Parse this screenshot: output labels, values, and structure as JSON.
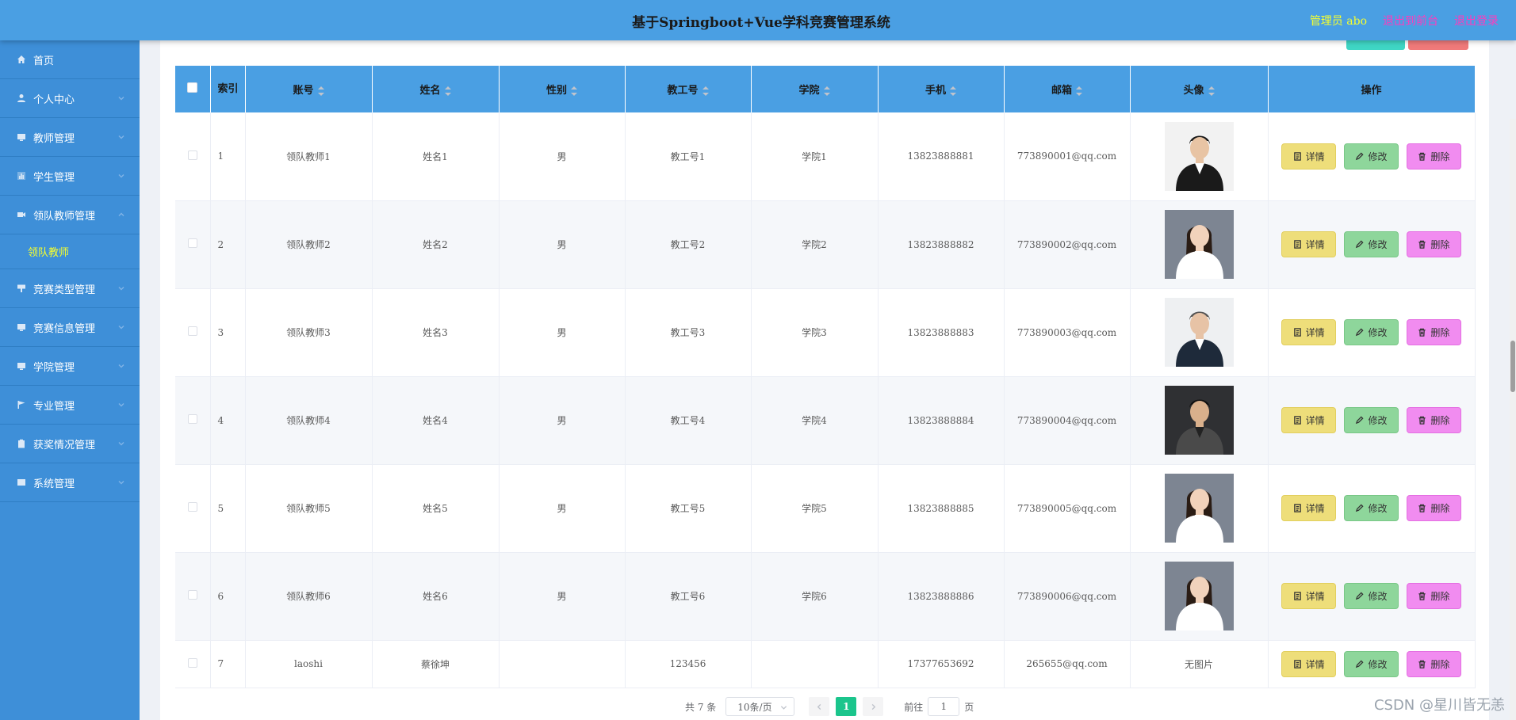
{
  "header": {
    "title": "基于Springboot+Vue学科竞赛管理系统",
    "admin_label": "管理员 abo",
    "to_front": "退出到前台",
    "logout": "退出登录"
  },
  "sidebar": {
    "items": [
      {
        "label": "首页",
        "icon": "home-icon"
      },
      {
        "label": "个人中心",
        "icon": "user-icon"
      },
      {
        "label": "教师管理",
        "icon": "monitor-icon"
      },
      {
        "label": "学生管理",
        "icon": "chart-icon"
      },
      {
        "label": "领队教师管理",
        "icon": "video-icon"
      },
      {
        "label": "竞赛类型管理",
        "icon": "flag-icon"
      },
      {
        "label": "竞赛信息管理",
        "icon": "monitor-icon"
      },
      {
        "label": "学院管理",
        "icon": "monitor-icon"
      },
      {
        "label": "专业管理",
        "icon": "flag-icon"
      },
      {
        "label": "获奖情况管理",
        "icon": "clipboard-icon"
      },
      {
        "label": "系统管理",
        "icon": "monitor-icon"
      }
    ],
    "active_sub": "领队教师"
  },
  "table": {
    "columns": {
      "index": "索引",
      "account": "账号",
      "name": "姓名",
      "gender": "性别",
      "staff_no": "教工号",
      "college": "学院",
      "phone": "手机",
      "email": "邮箱",
      "avatar": "头像",
      "ops": "操作"
    },
    "rows": [
      {
        "index": "1",
        "account": "领队教师1",
        "name": "姓名1",
        "gender": "男",
        "staff_no": "教工号1",
        "college": "学院1",
        "phone": "13823888881",
        "email": "773890001@qq.com"
      },
      {
        "index": "2",
        "account": "领队教师2",
        "name": "姓名2",
        "gender": "男",
        "staff_no": "教工号2",
        "college": "学院2",
        "phone": "13823888882",
        "email": "773890002@qq.com"
      },
      {
        "index": "3",
        "account": "领队教师3",
        "name": "姓名3",
        "gender": "男",
        "staff_no": "教工号3",
        "college": "学院3",
        "phone": "13823888883",
        "email": "773890003@qq.com"
      },
      {
        "index": "4",
        "account": "领队教师4",
        "name": "姓名4",
        "gender": "男",
        "staff_no": "教工号4",
        "college": "学院4",
        "phone": "13823888884",
        "email": "773890004@qq.com"
      },
      {
        "index": "5",
        "account": "领队教师5",
        "name": "姓名5",
        "gender": "男",
        "staff_no": "教工号5",
        "college": "学院5",
        "phone": "13823888885",
        "email": "773890005@qq.com"
      },
      {
        "index": "6",
        "account": "领队教师6",
        "name": "姓名6",
        "gender": "男",
        "staff_no": "教工号6",
        "college": "学院6",
        "phone": "13823888886",
        "email": "773890006@qq.com"
      },
      {
        "index": "7",
        "account": "laoshi",
        "name": "蔡徐坤",
        "gender": "",
        "staff_no": "123456",
        "college": "",
        "phone": "17377653692",
        "email": "265655@qq.com",
        "avatar_text": "无图片"
      }
    ],
    "actions": {
      "detail": "详情",
      "edit": "修改",
      "delete": "删除"
    }
  },
  "pagination": {
    "total": "共 7 条",
    "page_size": "10条/页",
    "current_page": "1",
    "goto_label": "前往",
    "goto_value": "1",
    "page_unit": "页"
  },
  "watermark": "CSDN @星川皆无恙",
  "colors": {
    "header_bg": "#4a9fe3",
    "sidebar_bg": "#3e8fd8",
    "active_sub": "#f6ff2e",
    "link_pink": "#ff3bbd",
    "page_active": "#1bc58c",
    "btn_detail": "#eede7a",
    "btn_edit": "#8ed69b",
    "btn_delete": "#f18cf0"
  }
}
